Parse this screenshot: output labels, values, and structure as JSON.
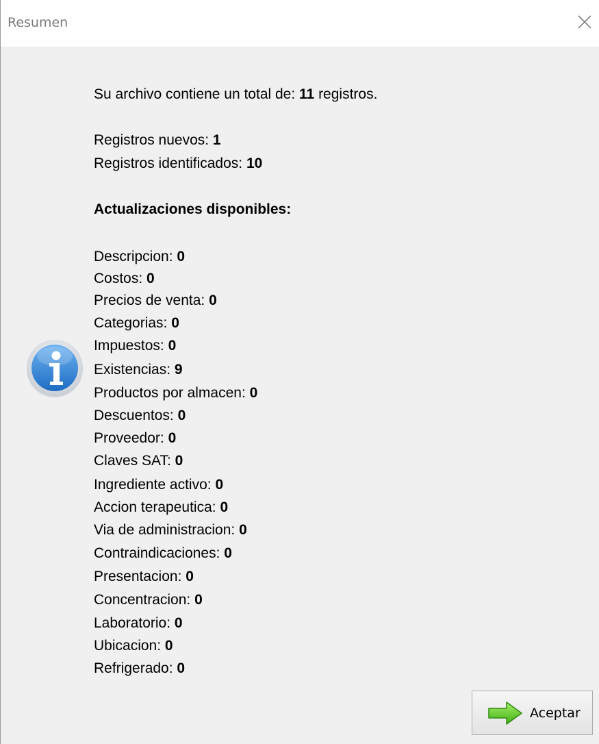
{
  "window": {
    "title": "Resumen"
  },
  "summary": {
    "total_prefix": "Su archivo contiene un total de: ",
    "total_value": "11",
    "total_suffix": " registros.",
    "new_label": "Registros nuevos: ",
    "new_value": "1",
    "identified_label": "Registros identificados: ",
    "identified_value": "10",
    "updates_heading": "Actualizaciones disponibles:"
  },
  "updates": [
    {
      "label": "Descripcion: ",
      "value": "0"
    },
    {
      "label": "Costos: ",
      "value": "0"
    },
    {
      "label": "Precios de venta: ",
      "value": "0"
    },
    {
      "label": "Categorias: ",
      "value": "0"
    },
    {
      "label": "Impuestos: ",
      "value": "0"
    },
    {
      "label": "Existencias: ",
      "value": "9"
    },
    {
      "label": "Productos por almacen: ",
      "value": "0"
    },
    {
      "label": "Descuentos: ",
      "value": "0"
    },
    {
      "label": "Proveedor: ",
      "value": "0"
    },
    {
      "label": "Claves SAT: ",
      "value": "0"
    },
    {
      "label": "Ingrediente activo: ",
      "value": "0"
    },
    {
      "label": "Accion terapeutica: ",
      "value": "0"
    },
    {
      "label": "Via de administracion: ",
      "value": "0"
    },
    {
      "label": "Contraindicaciones: ",
      "value": "0"
    },
    {
      "label": "Presentacion: ",
      "value": "0"
    },
    {
      "label": "Concentracion: ",
      "value": "0"
    },
    {
      "label": "Laboratorio: ",
      "value": "0"
    },
    {
      "label": "Ubicacion: ",
      "value": "0"
    },
    {
      "label": "Refrigerado: ",
      "value": "0"
    }
  ],
  "buttons": {
    "ok_label": "Aceptar"
  },
  "icons": {
    "info": "info-icon",
    "close": "close-icon",
    "arrow": "arrow-right-icon"
  },
  "colors": {
    "info_blue": "#2f86d8",
    "arrow_green": "#5fcf2a"
  }
}
